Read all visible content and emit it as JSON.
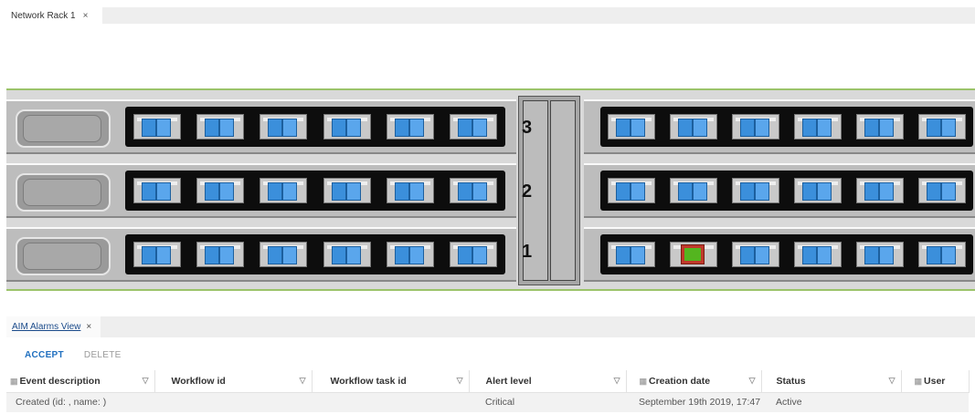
{
  "top_tab": {
    "label": "Network Rack 1",
    "close": "×"
  },
  "rack": {
    "row_numbers": [
      "3",
      "2",
      "1"
    ],
    "colors": {
      "port": "#3b8fdb",
      "alarm_border": "#c0392b",
      "alarm_fill": "#54b51f"
    },
    "alarmed_port": {
      "row": "1",
      "side": "right",
      "index": 2
    }
  },
  "panel": {
    "tab_label": "AIM Alarms View",
    "tab_close": "×",
    "toolbar": {
      "accept_label": "ACCEPT",
      "delete_label": "DELETE"
    },
    "table": {
      "columns": [
        {
          "label": "Event description",
          "locked": true
        },
        {
          "label": "Workflow id",
          "locked": false
        },
        {
          "label": "Workflow task id",
          "locked": false
        },
        {
          "label": "Alert level",
          "locked": false
        },
        {
          "label": "Creation date",
          "locked": true
        },
        {
          "label": "Status",
          "locked": false
        },
        {
          "label": "User",
          "locked": true
        }
      ],
      "rows": [
        {
          "event_description": "Created (id: , name: )",
          "workflow_id": "",
          "workflow_task_id": "",
          "alert_level": "Critical",
          "creation_date": "September 19th 2019, 17:47",
          "status": "Active",
          "user": ""
        }
      ]
    }
  }
}
